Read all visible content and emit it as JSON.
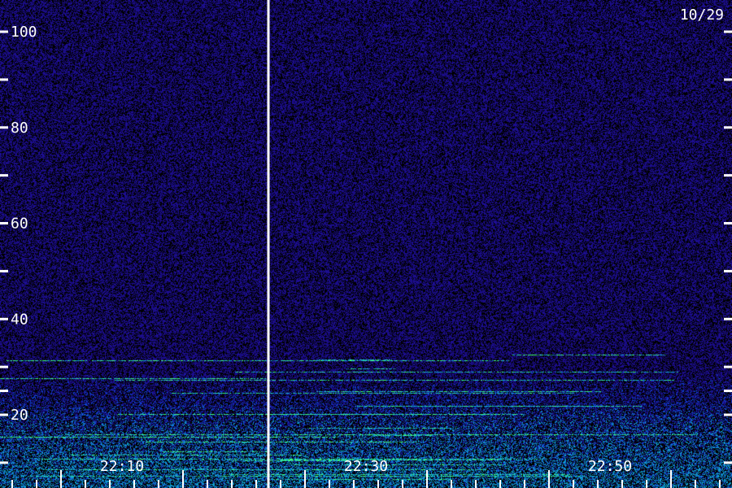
{
  "chart_data": {
    "type": "heatmap",
    "date_label": "10/29",
    "y_ticks": [
      {
        "value": 10,
        "label": ""
      },
      {
        "value": 20,
        "label": "20"
      },
      {
        "value": 25,
        "label": ""
      },
      {
        "value": 30,
        "label": ""
      },
      {
        "value": 40,
        "label": "40"
      },
      {
        "value": 50,
        "label": ""
      },
      {
        "value": 60,
        "label": "60"
      },
      {
        "value": 70,
        "label": ""
      },
      {
        "value": 80,
        "label": "80"
      },
      {
        "value": 90,
        "label": ""
      },
      {
        "value": 100,
        "label": "100"
      }
    ],
    "ylim": [
      8,
      105
    ],
    "x_labels": [
      "22:10",
      "22:30",
      "22:50"
    ],
    "x_range_minutes": [
      "22:00",
      "23:00"
    ],
    "marker_time": "22:22",
    "colors": {
      "background": "#000000",
      "noise": "#2010a0",
      "band_low": "#1040d0",
      "band_mid": "#10a0d0",
      "band_high": "#40ff80",
      "text": "#ffffff"
    }
  }
}
